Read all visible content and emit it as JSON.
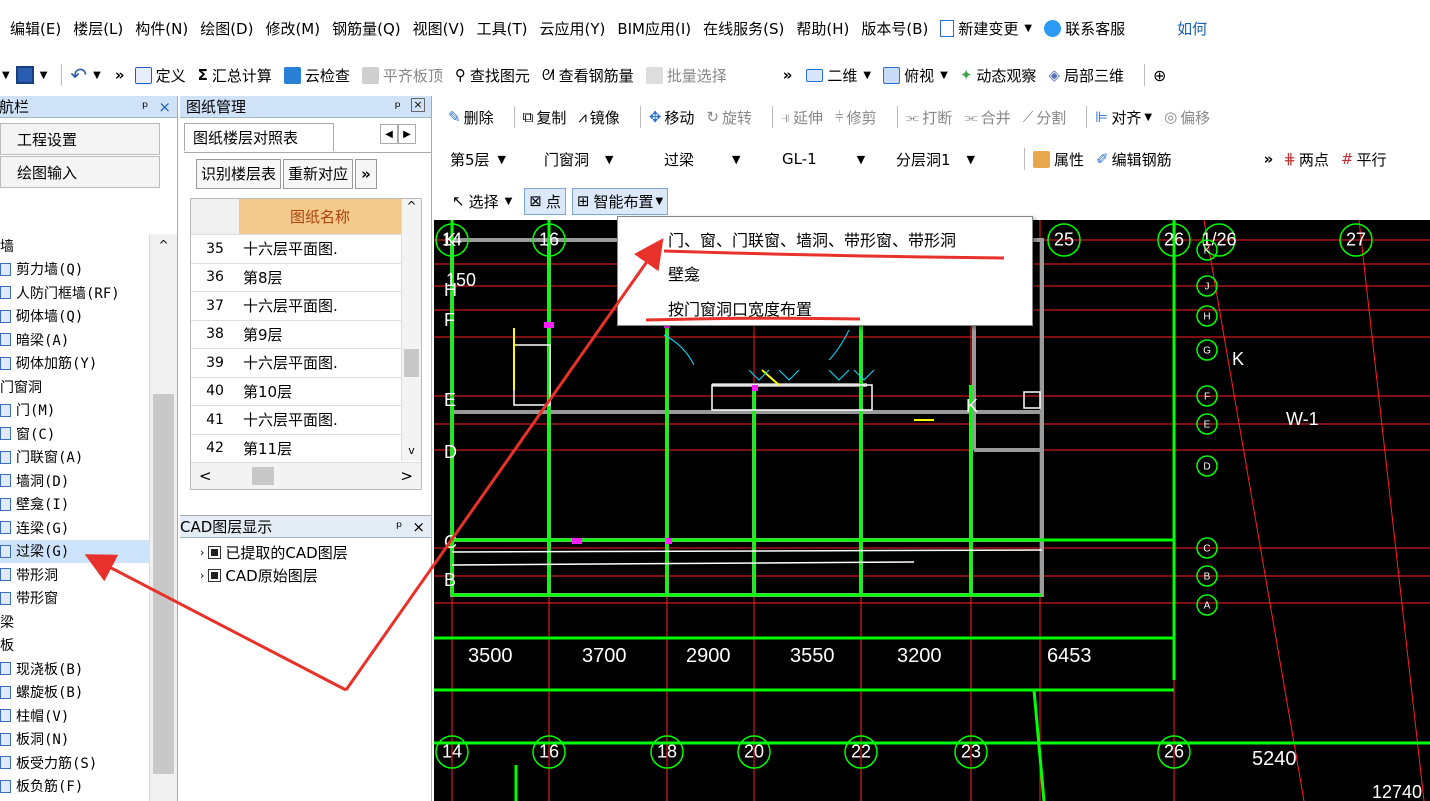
{
  "menubar": {
    "items": [
      "编辑(E)",
      "楼层(L)",
      "构件(N)",
      "绘图(D)",
      "修改(M)",
      "钢筋量(Q)",
      "视图(V)",
      "工具(T)",
      "云应用(Y)",
      "BIM应用(I)",
      "在线服务(S)",
      "帮助(H)",
      "版本号(B)"
    ],
    "new_change": "新建变更",
    "service": "联系客服",
    "right_cut": "如何"
  },
  "toolbar1": {
    "define": "定义",
    "sum": "汇总计算",
    "cloud_check": "云检查",
    "flat_top": "平齐板顶",
    "find": "查找图元",
    "view_rebar": "查看钢筋量",
    "batch_select": "批量选择",
    "view2d": "二维",
    "top_view": "俯视",
    "dynamic": "动态观察",
    "local3d": "局部三维"
  },
  "leftpanel": {
    "title": "导航栏",
    "pin": "ᵖ",
    "close": "×",
    "tab1": "工程设置",
    "tab2": "绘图输入",
    "tree": [
      {
        "label": "墙",
        "type": "group"
      },
      {
        "label": "剪力墙(Q)",
        "type": "item"
      },
      {
        "label": "人防门框墙(RF)",
        "type": "item"
      },
      {
        "label": "砌体墙(Q)",
        "type": "item"
      },
      {
        "label": "暗梁(A)",
        "type": "item"
      },
      {
        "label": "砌体加筋(Y)",
        "type": "item"
      },
      {
        "label": "门窗洞",
        "type": "group"
      },
      {
        "label": "门(M)",
        "type": "item"
      },
      {
        "label": "窗(C)",
        "type": "item"
      },
      {
        "label": "门联窗(A)",
        "type": "item"
      },
      {
        "label": "墙洞(D)",
        "type": "item"
      },
      {
        "label": "壁龛(I)",
        "type": "item"
      },
      {
        "label": "连梁(G)",
        "type": "item"
      },
      {
        "label": "过梁(G)",
        "type": "item",
        "selected": true
      },
      {
        "label": "带形洞",
        "type": "item"
      },
      {
        "label": "带形窗",
        "type": "item"
      },
      {
        "label": "梁",
        "type": "group"
      },
      {
        "label": "板",
        "type": "group"
      },
      {
        "label": "现浇板(B)",
        "type": "item"
      },
      {
        "label": "螺旋板(B)",
        "type": "item"
      },
      {
        "label": "柱帽(V)",
        "type": "item"
      },
      {
        "label": "板洞(N)",
        "type": "item"
      },
      {
        "label": "板受力筋(S)",
        "type": "item"
      },
      {
        "label": "板负筋(F)",
        "type": "item"
      }
    ]
  },
  "drawpanel": {
    "title": "图纸管理",
    "tab": "图纸楼层对照表",
    "btn_identify": "识别楼层表",
    "btn_remap": "重新对应",
    "col_name": "图纸名称",
    "rows": [
      {
        "n": "35",
        "t": "十六层平面图."
      },
      {
        "n": "36",
        "t": "第8层"
      },
      {
        "n": "37",
        "t": "十六层平面图."
      },
      {
        "n": "38",
        "t": "第9层"
      },
      {
        "n": "39",
        "t": "十六层平面图."
      },
      {
        "n": "40",
        "t": "第10层"
      },
      {
        "n": "41",
        "t": "十六层平面图."
      },
      {
        "n": "42",
        "t": "第11层"
      }
    ]
  },
  "cadpanel": {
    "title": "CAD图层显示",
    "layer1": "已提取的CAD图层",
    "layer2": "CAD原始图层"
  },
  "rtool1": {
    "delete": "删除",
    "copy": "复制",
    "mirror": "镜像",
    "move": "移动",
    "rotate": "旋转",
    "extend": "延伸",
    "trim": "修剪",
    "break": "打断",
    "merge": "合并",
    "split": "分割",
    "align": "对齐",
    "offset": "偏移"
  },
  "rtool2": {
    "floor": "第5层",
    "category": "门窗洞",
    "type": "过梁",
    "element": "GL-1",
    "layer_hole": "分层洞1",
    "property": "属性",
    "edit_rebar": "编辑钢筋",
    "two_point": "两点",
    "parallel": "平行"
  },
  "rtool3": {
    "select": "选择",
    "point": "点",
    "smart": "智能布置"
  },
  "popup": {
    "item1": "门、窗、门联窗、墙洞、带形窗、带形洞",
    "item2": "壁龛",
    "item3": "按门窗洞口宽度布置"
  },
  "cad": {
    "axis_top": [
      "14",
      "16",
      "25",
      "26",
      "1/26",
      "27"
    ],
    "axis_bottom": [
      "14",
      "16",
      "18",
      "20",
      "22",
      "23",
      "26"
    ],
    "row_left": [
      "K",
      "H",
      "F",
      "E",
      "D",
      "C",
      "B"
    ],
    "row_right": [
      "K",
      "J",
      "H",
      "G",
      "F",
      "E",
      "D",
      "C",
      "B",
      "A"
    ],
    "dims": [
      "3500",
      "3700",
      "2900",
      "3550",
      "3200",
      "6453"
    ],
    "dim_right": "5240",
    "dim_corner": "12740",
    "wlabel": "W-1",
    "klabel": "K",
    "h150": "150"
  }
}
